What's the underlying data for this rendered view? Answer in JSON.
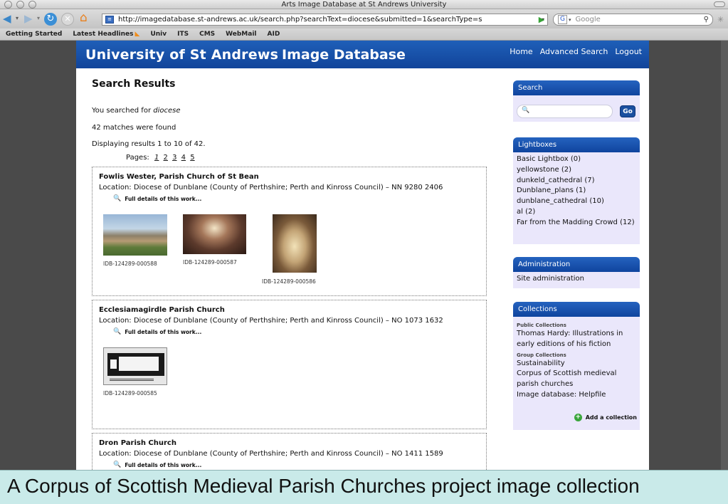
{
  "window": {
    "title": "Arts Image Database at St Andrews University"
  },
  "browser": {
    "url": "http://imagedatabase.st-andrews.ac.uk/search.php?searchText=diocese&submitted=1&searchType=s",
    "search_placeholder": "Google",
    "bookmarks": [
      "Getting Started",
      "Latest Headlines",
      "Univ",
      "ITS",
      "CMS",
      "WebMail",
      "AID"
    ]
  },
  "header": {
    "site_name": "University of St Andrews",
    "db_name": "Image Database",
    "nav": [
      "Home",
      "Advanced Search",
      "Logout"
    ]
  },
  "main": {
    "heading": "Search Results",
    "searched_prefix": "You searched for ",
    "searched_term": "diocese",
    "matches": "42 matches were found",
    "displaying": "Displaying results 1 to 10 of 42.",
    "pages_label": "Pages:",
    "current_page": "1",
    "pages": [
      "2",
      "3",
      "4",
      "5"
    ],
    "details_link": "Full details of this work...",
    "results": [
      {
        "title": "Fowlis Wester, Parish Church of St Bean",
        "location": "Location: Diocese of Dunblane (County of Perthshire; Perth and Kinross Council) – NN 9280 2406",
        "images": [
          "IDB-124289-000588",
          "IDB-124289-000587",
          "IDB-124289-000586"
        ]
      },
      {
        "title": "Ecclesiamagirdle Parish Church",
        "location": "Location: Diocese of Dunblane (County of Perthshire; Perth and Kinross Council) – NO 1073 1632",
        "images": [
          "IDB-124289-000585"
        ]
      },
      {
        "title": "Dron Parish Church",
        "location": "Location: Diocese of Dunblane (County of Perthshire; Perth and Kinross Council) – NO 1411 1589",
        "images": []
      }
    ]
  },
  "sidebar": {
    "search": {
      "heading": "Search",
      "go_label": "Go"
    },
    "lightboxes": {
      "heading": "Lightboxes",
      "items": [
        "Basic Lightbox (0)",
        "yellowstone (2)",
        "dunkeld_cathedral (7)",
        "Dunblane_plans (1)",
        "dunblane_cathedral (10)",
        "al (2)",
        "Far from the Madding Crowd (12)"
      ]
    },
    "administration": {
      "heading": "Administration",
      "items": [
        "Site administration"
      ]
    },
    "collections": {
      "heading": "Collections",
      "public_label": "Public Collections",
      "public_items": [
        "Thomas Hardy: Illustrations in early editions of his fiction"
      ],
      "group_label": "Group Collections",
      "group_items": [
        "Sustainability",
        "Corpus of Scottish medieval parish churches",
        "Image database: Helpfile"
      ],
      "add_label": "Add a collection"
    }
  },
  "caption": "A Corpus of Scottish Medieval Parish Churches project image collection"
}
